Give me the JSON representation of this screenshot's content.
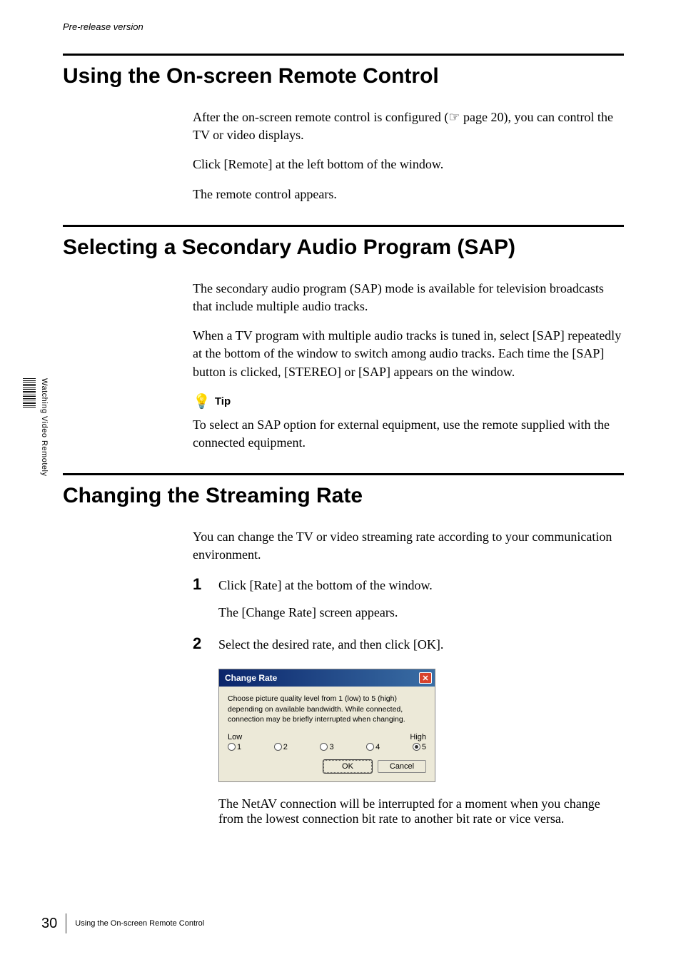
{
  "header": "Pre-release version",
  "sidebar": {
    "label": "Watching Video Remotely"
  },
  "sections": [
    {
      "title": "Using the On-screen Remote Control",
      "p1a": "After the on-screen remote control is configured (",
      "p1b": " page 20), you can control the TV or video displays.",
      "p2": "Click [Remote] at the left bottom of the window.",
      "p3": "The remote control appears."
    },
    {
      "title": "Selecting a Secondary Audio Program (SAP)",
      "p1": "The secondary audio program (SAP) mode is available for television broadcasts that include multiple audio tracks.",
      "p2": "When a TV program with multiple audio tracks is tuned in, select [SAP] repeatedly at the bottom of the window to switch among audio tracks. Each time the [SAP] button is clicked, [STEREO] or [SAP] appears on the window.",
      "tip_label": "Tip",
      "tip_text": "To select an SAP option for external equipment, use the remote supplied with the connected equipment."
    },
    {
      "title": "Changing the Streaming Rate",
      "p1": "You can change the TV or video streaming rate according to your communication environment.",
      "step1_num": "1",
      "step1": "Click [Rate] at the bottom of the window.",
      "step1_sub": "The [Change Rate] screen appears.",
      "step2_num": "2",
      "step2": "Select the desired rate, and then click [OK].",
      "after": "The NetAV connection will be interrupted for a moment when you change from the lowest connection bit rate to another bit rate or vice versa."
    }
  ],
  "dialog": {
    "title": "Change Rate",
    "desc": "Choose picture quality level from 1 (low) to 5 (high) depending on available bandwidth. While connected, connection may be briefly interrupted when changing.",
    "low_label": "Low",
    "high_label": "High",
    "options": [
      "1",
      "2",
      "3",
      "4",
      "5"
    ],
    "selected": "5",
    "ok": "OK",
    "cancel": "Cancel"
  },
  "footer": {
    "page": "30",
    "title": "Using the On-screen Remote Control"
  }
}
